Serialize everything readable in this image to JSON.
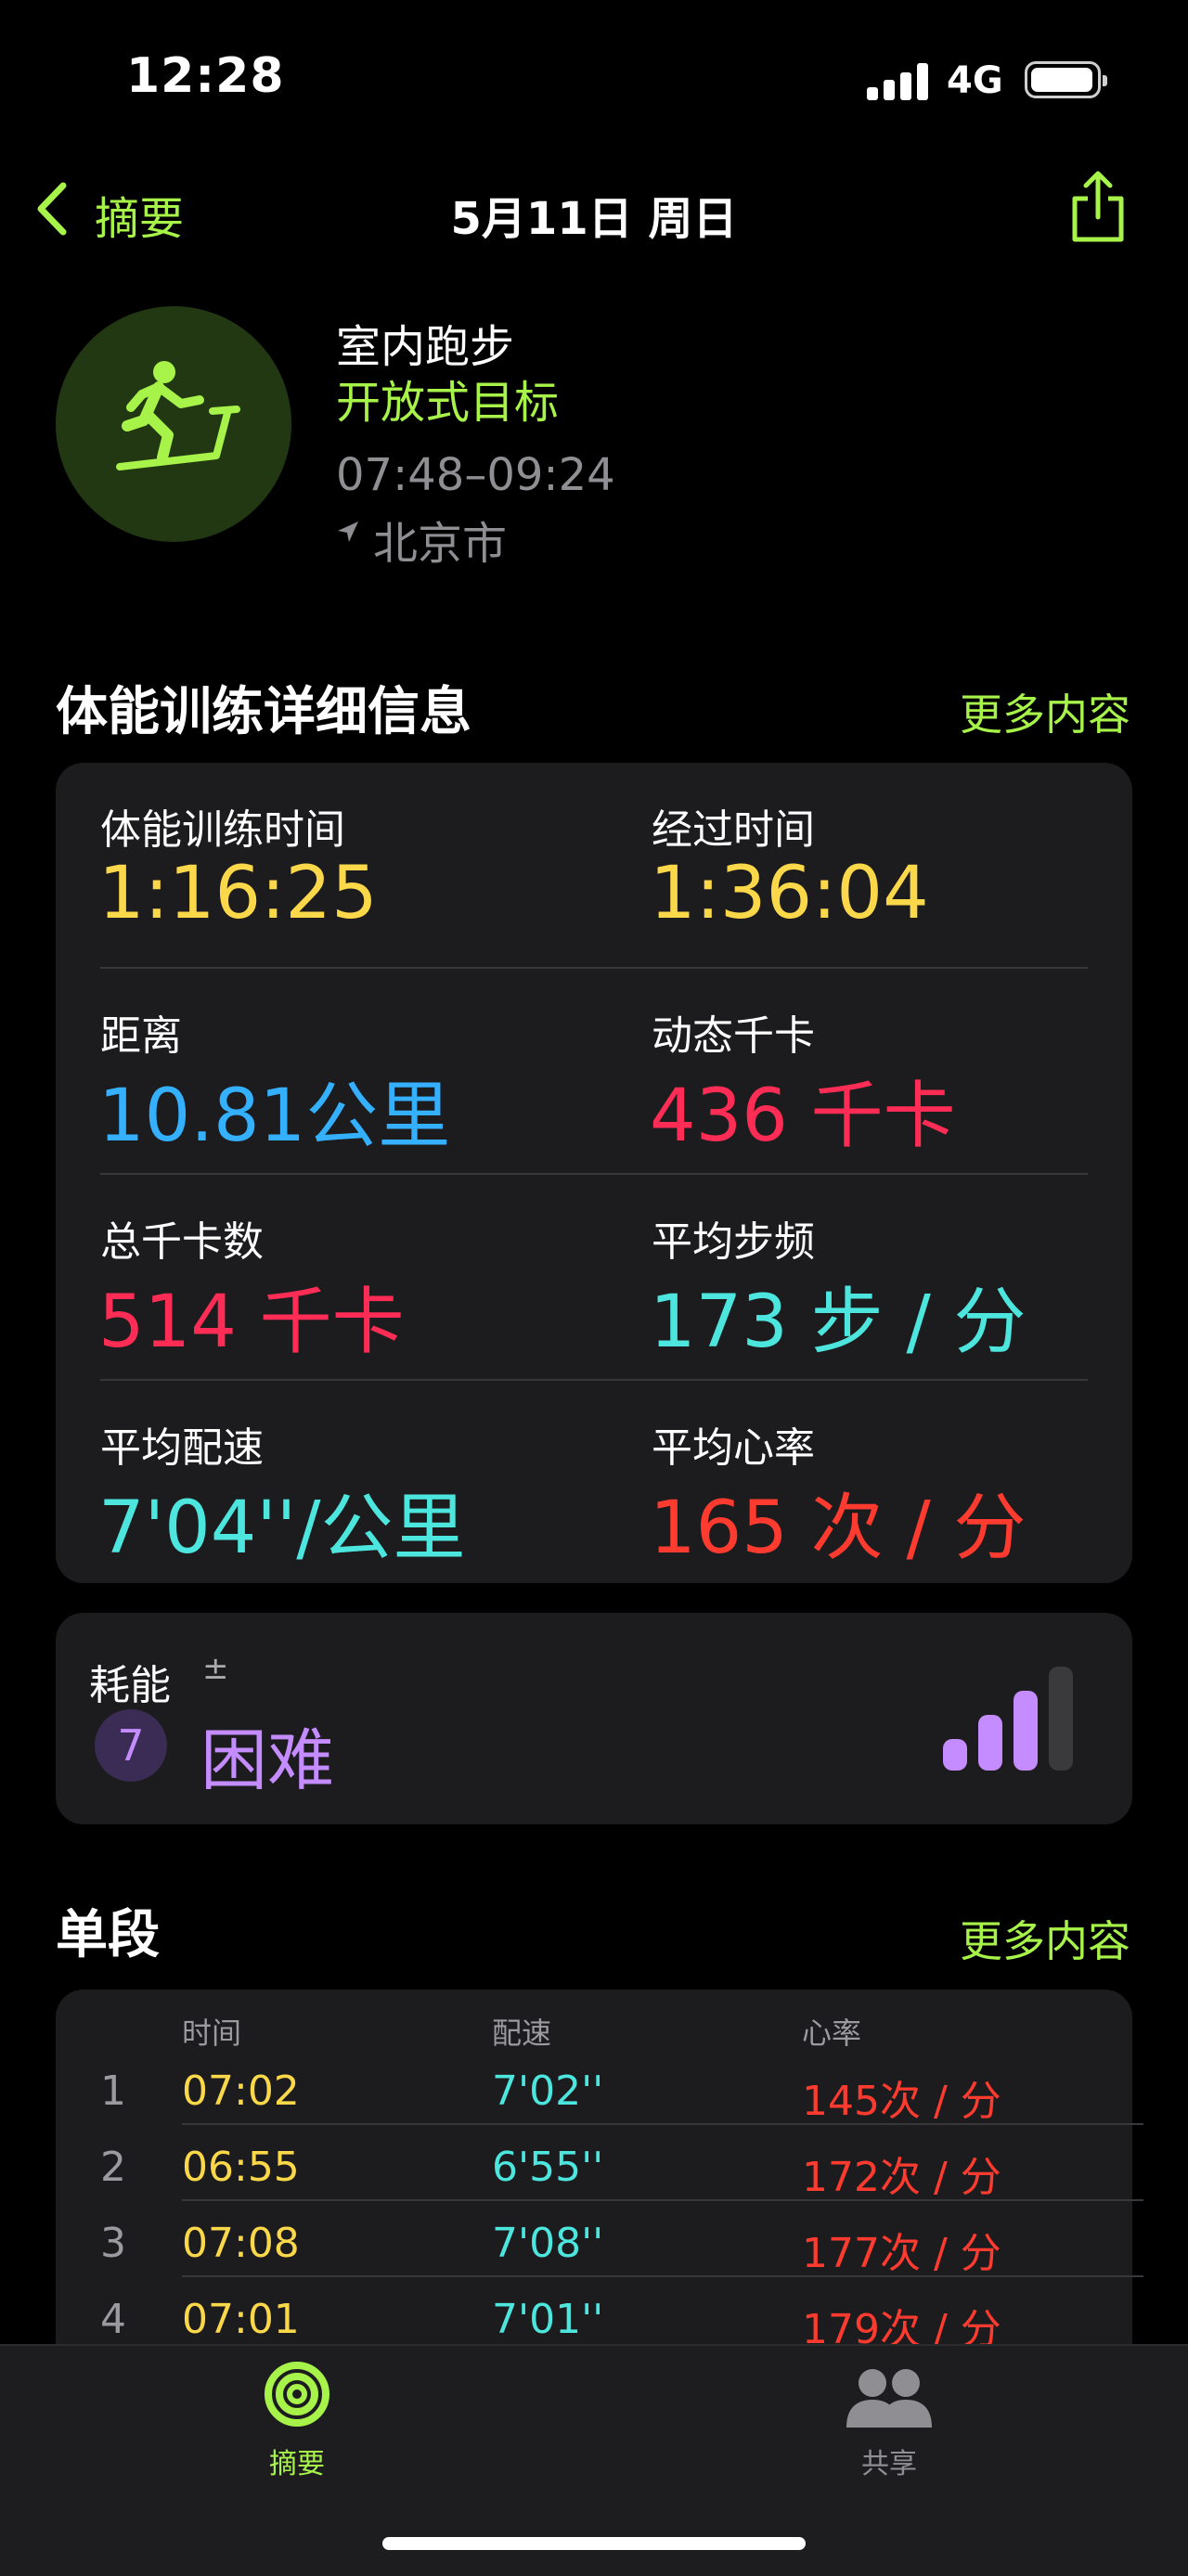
{
  "status_bar": {
    "time": "12:28",
    "network": "4G"
  },
  "nav": {
    "back_label": "摘要",
    "title": "5月11日 周日"
  },
  "workout": {
    "type": "室内跑步",
    "goal": "开放式目标",
    "time_range": "07:48–09:24",
    "location": "北京市"
  },
  "details": {
    "title": "体能训练详细信息",
    "more": "更多内容",
    "metrics": [
      {
        "label": "体能训练时间",
        "value": "1:16:25"
      },
      {
        "label": "经过时间",
        "value": "1:36:04"
      },
      {
        "label": "距离",
        "value": "10.81公里"
      },
      {
        "label": "动态千卡",
        "value": "436 千卡"
      },
      {
        "label": "总千卡数",
        "value": "514 千卡"
      },
      {
        "label": "平均步频",
        "value": "173 步 / 分"
      },
      {
        "label": "平均配速",
        "value": "7'04''/公里"
      },
      {
        "label": "平均心率",
        "value": "165 次 / 分"
      }
    ]
  },
  "effort": {
    "label": "耗能",
    "adjust": "±",
    "level": "7",
    "level_text": "困难",
    "bars_filled": 3,
    "bars_total": 4
  },
  "splits": {
    "title": "单段",
    "more": "更多内容",
    "headers": [
      "时间",
      "配速",
      "心率"
    ],
    "rows": [
      {
        "idx": "1",
        "time": "07:02",
        "pace": "7'02''",
        "hr": "145次 / 分"
      },
      {
        "idx": "2",
        "time": "06:55",
        "pace": "6'55''",
        "hr": "172次 / 分"
      },
      {
        "idx": "3",
        "time": "07:08",
        "pace": "7'08''",
        "hr": "177次 / 分"
      },
      {
        "idx": "4",
        "time": "07:01",
        "pace": "7'01''",
        "hr": "179次 / 分"
      }
    ]
  },
  "tabbar": {
    "summary_label": "摘要",
    "sharing_label": "共享"
  },
  "colors": {
    "accent": "#a7f34a",
    "yellow": "#fbd84a",
    "blue": "#34b0ff",
    "pink": "#ff2c55",
    "cyan": "#4de6de",
    "red": "#ff3b30",
    "purple": "#c48cff"
  }
}
